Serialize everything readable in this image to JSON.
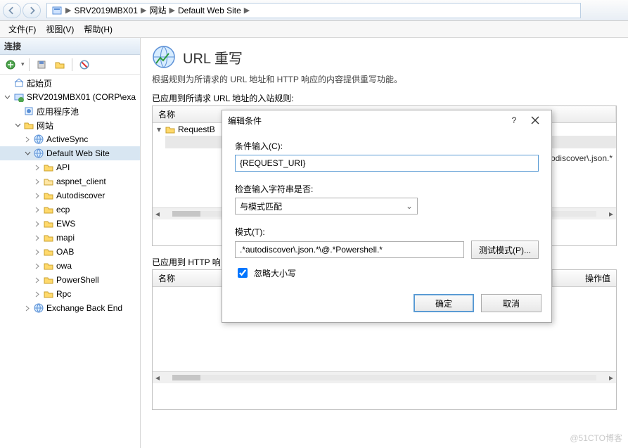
{
  "breadcrumb": {
    "host": "SRV2019MBX01",
    "site_group": "网站",
    "site": "Default Web Site"
  },
  "menus": {
    "file": "文件(F)",
    "view": "视图(V)",
    "help": "帮助(H)"
  },
  "left": {
    "header": "连接",
    "start_page": "起始页",
    "server": "SRV2019MBX01 (CORP\\exa",
    "app_pools": "应用程序池",
    "sites": "网站",
    "site_children": [
      "ActiveSync",
      "Default Web Site",
      "API",
      "aspnet_client",
      "Autodiscover",
      "ecp",
      "EWS",
      "mapi",
      "OAB",
      "owa",
      "PowerShell",
      "Rpc"
    ],
    "exchange_backend": "Exchange Back End"
  },
  "page": {
    "title": "URL 重写",
    "desc": "根据规则为所请求的 URL 地址和 HTTP 响应的内容提供重写功能。",
    "inbound_label": "已应用到所请求 URL 地址的入站规则:",
    "col_name": "名称",
    "rule_name": "RequestB",
    "peek_text": "odiscover\\.json.*",
    "outbound_label": "已应用到 HTTP 响",
    "col_name2": "名称",
    "col_opval": "操作值"
  },
  "dialog": {
    "title": "编辑条件",
    "help": "?",
    "label_input": "条件输入(C):",
    "input_value": "{REQUEST_URI}",
    "label_check": "检查输入字符串是否:",
    "check_value": "与模式匹配",
    "label_pattern": "模式(T):",
    "pattern_value": ".*autodiscover\\.json.*\\@.*Powershell.*",
    "test_btn": "测试模式(P)...",
    "ignore_case": "忽略大小写",
    "ok": "确定",
    "cancel": "取消"
  },
  "watermark": "@51CTO博客"
}
